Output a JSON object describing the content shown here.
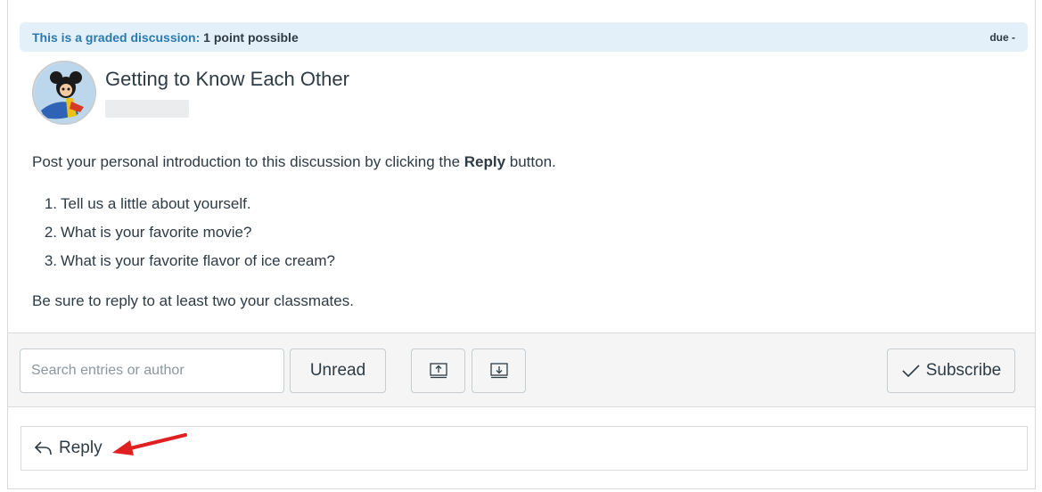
{
  "banner": {
    "lead": "This is a graded discussion:",
    "points": "1 point possible",
    "due": "due -"
  },
  "topic": {
    "title": "Getting to Know Each Other",
    "intro_before": "Post your personal introduction to this discussion by clicking the ",
    "intro_bold": "Reply",
    "intro_after": " button.",
    "prompts": [
      {
        "num": "1.",
        "text": "Tell us a little about yourself."
      },
      {
        "num": "2.",
        "text": "What is your favorite movie?"
      },
      {
        "num": "3.",
        "text": "What is your favorite flavor of ice cream?"
      }
    ],
    "closing": "Be sure to reply to at least two your classmates."
  },
  "toolbar": {
    "search_placeholder": "Search entries or author",
    "unread_label": "Unread",
    "subscribe_label": "Subscribe",
    "collapse_icon": "collapse-up-icon",
    "expand_icon": "expand-down-icon"
  },
  "reply": {
    "label": "Reply",
    "icon": "reply-arrow-icon"
  },
  "colors": {
    "banner_bg": "#e4f0f9",
    "banner_link": "#2a7ab0",
    "annotation_arrow": "#e02020"
  }
}
